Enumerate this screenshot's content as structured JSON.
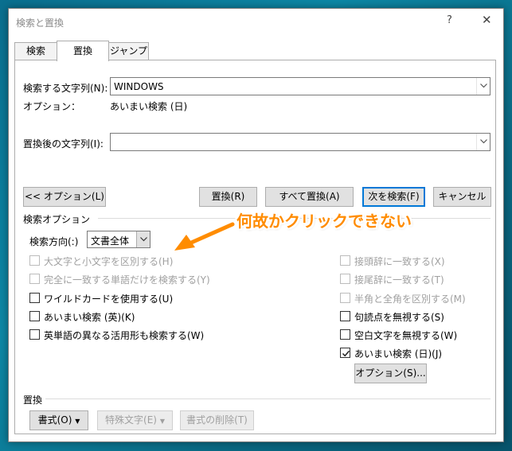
{
  "window": {
    "title": "検索と置換",
    "help_glyph": "?",
    "close_glyph": "✕"
  },
  "tabs": [
    {
      "label": "検索",
      "active": false
    },
    {
      "label": "置換",
      "active": true
    },
    {
      "label": "ジャンプ",
      "active": false
    }
  ],
  "find": {
    "label": "検索する文字列(N):",
    "value": "WINDOWS",
    "options_label": "オプション：",
    "options_value": "あいまい検索 (日)"
  },
  "replace": {
    "label": "置換後の文字列(I):",
    "value": ""
  },
  "buttons": {
    "less_options": "<< オプション(L)",
    "replace": "置換(R)",
    "replace_all": "すべて置換(A)",
    "find_next": "次を検索(F)",
    "cancel": "キャンセル"
  },
  "search_options": {
    "heading": "検索オプション",
    "direction_label": "検索方向(:)",
    "direction_value": "文書全体"
  },
  "left_checks": [
    {
      "label": "大文字と小文字を区別する(H)",
      "checked": false,
      "disabled": true
    },
    {
      "label": "完全に一致する単語だけを検索する(Y)",
      "checked": false,
      "disabled": true
    },
    {
      "label": "ワイルドカードを使用する(U)",
      "checked": false,
      "disabled": false
    },
    {
      "label": "あいまい検索 (英)(K)",
      "checked": false,
      "disabled": false
    },
    {
      "label": "英単語の異なる活用形も検索する(W)",
      "checked": false,
      "disabled": false
    }
  ],
  "right_checks": [
    {
      "label": "接頭辞に一致する(X)",
      "checked": false,
      "disabled": true
    },
    {
      "label": "接尾辞に一致する(T)",
      "checked": false,
      "disabled": true
    },
    {
      "label": "半角と全角を区別する(M)",
      "checked": false,
      "disabled": true
    },
    {
      "label": "句読点を無視する(S)",
      "checked": false,
      "disabled": false
    },
    {
      "label": "空白文字を無視する(W)",
      "checked": false,
      "disabled": false
    },
    {
      "label": "あいまい検索 (日)(J)",
      "checked": true,
      "disabled": false
    }
  ],
  "fuzzy_options_button": "オプション(S)...",
  "replace_section": {
    "heading": "置換",
    "format": "書式(O)",
    "special": "特殊文字(E)",
    "no_format": "書式の削除(T)"
  },
  "annotation": {
    "text": "何故かクリックできない",
    "color": "#ff8c00"
  },
  "colors": {
    "accent": "#0078d7",
    "disabled_text": "#a0a0a0"
  }
}
